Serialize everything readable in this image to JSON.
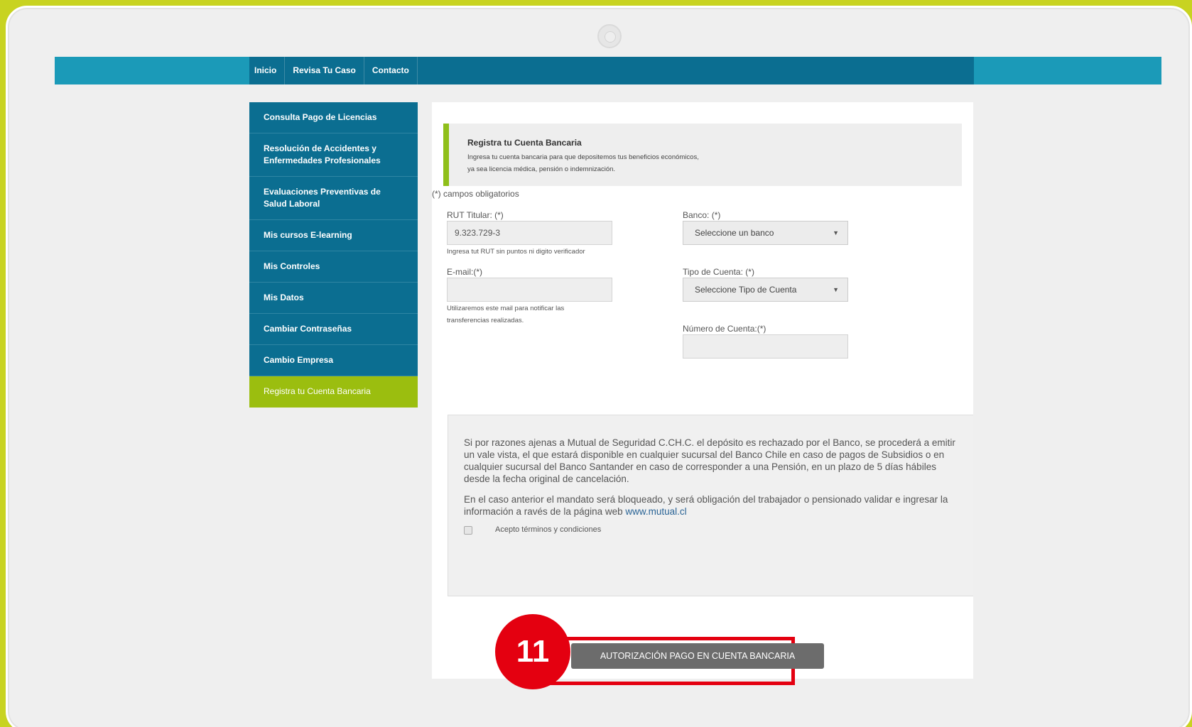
{
  "nav": {
    "items": [
      {
        "label": "Inicio"
      },
      {
        "label": "Revisa Tu Caso"
      },
      {
        "label": "Contacto"
      }
    ]
  },
  "sidebar": {
    "items": [
      {
        "label": "Consulta Pago de Licencias"
      },
      {
        "label": "Resolución de Accidentes y Enfermedades Profesionales"
      },
      {
        "label": "Evaluaciones Preventivas de Salud Laboral"
      },
      {
        "label": "Mis cursos E-learning"
      },
      {
        "label": "Mis Controles"
      },
      {
        "label": "Mis Datos"
      },
      {
        "label": "Cambiar Contraseñas"
      },
      {
        "label": "Cambio Empresa"
      },
      {
        "label": "Registra tu Cuenta Bancaria"
      }
    ],
    "active_index": 8
  },
  "callout": {
    "title": "Registra tu Cuenta Bancaria",
    "line1": "Ingresa tu cuenta bancaria para que depositemos tus beneficios económicos,",
    "line2": "ya sea licencia médica, pensión o indemnización."
  },
  "form": {
    "required_note": "(*) campos obligatorios",
    "rut": {
      "label": "RUT Titular: (*)",
      "value": "9.323.729-3",
      "help": "Ingresa tut RUT sin puntos ni digito verificador"
    },
    "email": {
      "label": "E-mail:(*)",
      "value": "",
      "help_line1": "Utilizaremos este mail para notificar las",
      "help_line2": "transferencias realizadas."
    },
    "bank": {
      "label": "Banco: (*)",
      "selected": "Seleccione un banco"
    },
    "account_type": {
      "label": "Tipo de Cuenta: (*)",
      "selected": "Seleccione Tipo de Cuenta"
    },
    "account_number": {
      "label": "Número de Cuenta:(*)",
      "value": ""
    }
  },
  "terms": {
    "paragraph1": "Si por razones ajenas a Mutual de Seguridad C.CH.C. el depósito es rechazado por el Banco, se procederá a emitir un vale vista, el que estará disponible en cualquier sucursal del Banco Chile en caso de pagos de Subsidios o en cualquier sucursal del Banco Santander en caso de corresponder a una Pensión, en un plazo de 5 días hábiles desde la fecha original de cancelación.",
    "paragraph2": "En el caso anterior el mandato será bloqueado, y será obligación del trabajador o pensionado validar e ingresar la información a ravés de la página web",
    "link": "www.mutual.cl",
    "checkbox_label": "Acepto términos y condiciones",
    "checked": false
  },
  "submit_label": "AUTORIZACIÓN PAGO EN CUENTA BANCARIA",
  "step_badge": "11",
  "colors": {
    "background": "#c8d321",
    "nav_blue": "#0b6e91",
    "active_green": "#9bbe0f",
    "highlight_red": "#e40010"
  }
}
